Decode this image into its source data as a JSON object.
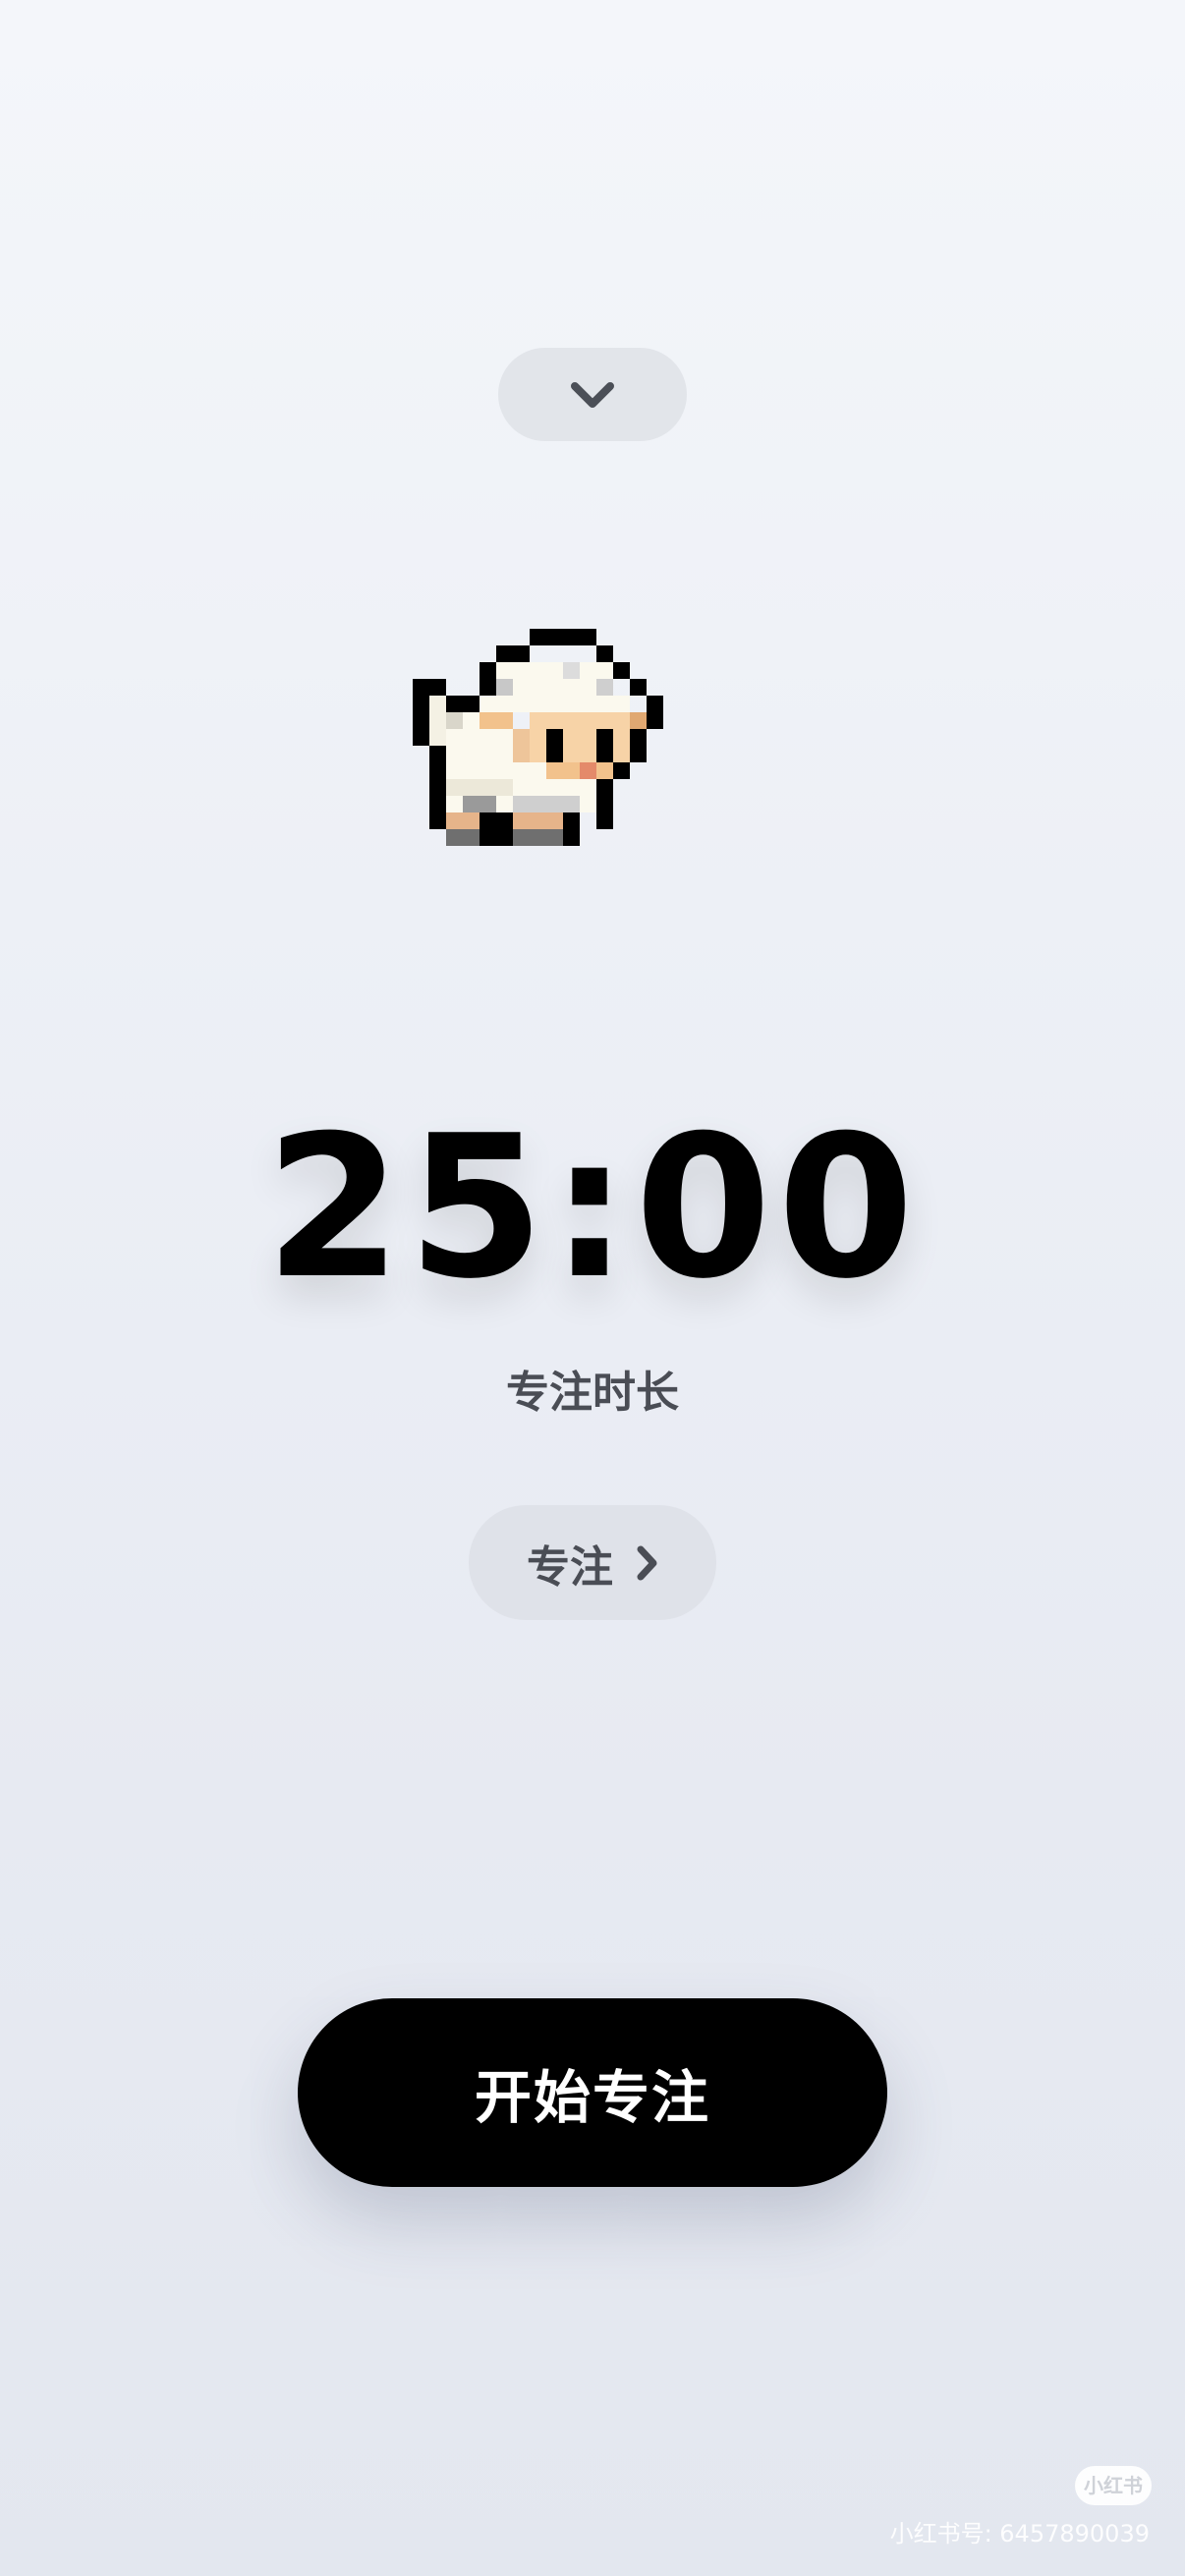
{
  "header": {
    "collapse_icon": "chevron-down-icon"
  },
  "illustration": {
    "icon": "pixel-sheep-icon"
  },
  "timer": {
    "value": "25:00",
    "label": "专注时长"
  },
  "mode": {
    "label": "专注",
    "icon": "chevron-right-icon"
  },
  "start_button": {
    "label": "开始专注"
  },
  "watermark": {
    "logo": "小红书",
    "text": "小红书号: 6457890039"
  },
  "colors": {
    "background": "#eef1f6",
    "primary_button": "#000000",
    "pill": "#e0e3ea",
    "secondary_text": "#4a4d55"
  }
}
